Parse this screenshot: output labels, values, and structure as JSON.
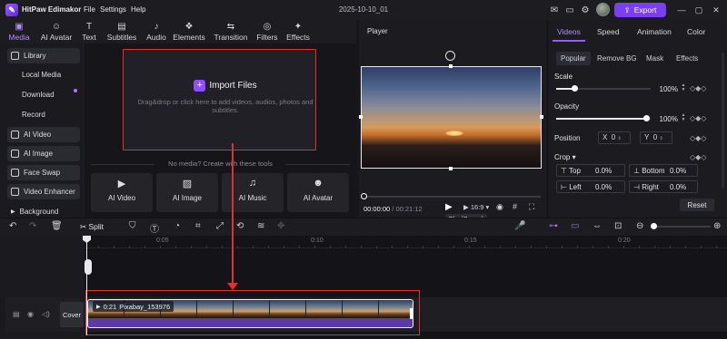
{
  "app": {
    "name": "HitPaw Edimakor",
    "project": "2025-10-10_01",
    "export_label": "Export"
  },
  "menu": [
    "File",
    "Settings",
    "Help"
  ],
  "tabs": [
    "Media",
    "AI Avatar",
    "Text",
    "Subtitles",
    "Audio",
    "Elements",
    "Transition",
    "Filters",
    "Effects"
  ],
  "active_tab": "Media",
  "sidebar": {
    "library": "Library",
    "local_media": "Local Media",
    "download": "Download",
    "record": "Record",
    "ai_video": "AI Video",
    "ai_image": "AI Image",
    "face_swap": "Face Swap",
    "video_enhancer": "Video Enhancer",
    "background": "Background"
  },
  "media": {
    "import_label": "Import Files",
    "import_hint": "Drag&drop or click here to add videos, audios, photos and subtitles.",
    "no_media": "No media? Create with these tools",
    "tools": [
      "AI Video",
      "AI Image",
      "AI Music",
      "AI Avatar"
    ]
  },
  "player": {
    "label": "Player",
    "current_time": "00:00:00",
    "total_time": "/ 00:21:12",
    "ratio": "16:9",
    "tooltip": "Play(Space)"
  },
  "props": {
    "tabs": [
      "Videos",
      "Speed",
      "Animation",
      "Color"
    ],
    "active_tab": "Videos",
    "subtabs": [
      "Popular",
      "Remove BG",
      "Mask",
      "Effects"
    ],
    "scale_label": "Scale",
    "scale_value": "100%",
    "opacity_label": "Opacity",
    "opacity_value": "100%",
    "position_label": "Position",
    "pos_x_label": "X",
    "pos_x": "0",
    "pos_y_label": "Y",
    "pos_y": "0",
    "crop_label": "Crop",
    "crop": {
      "top": "Top",
      "top_val": "0.0%",
      "bottom": "Bottom",
      "bottom_val": "0.0%",
      "left": "Left",
      "left_val": "0.0%",
      "right": "Right",
      "right_val": "0.0%"
    },
    "reset_label": "Reset"
  },
  "timeline": {
    "split_label": "Split",
    "ticks": [
      "0:05",
      "0:10",
      "0:15",
      "0:20"
    ],
    "cover_label": "Cover",
    "clip_duration": "0:21",
    "clip_name": "Pixabay_153976"
  },
  "colors": {
    "accent": "#7b3ff2",
    "highlight": "#e03131",
    "clip": "#5b3aa8"
  }
}
